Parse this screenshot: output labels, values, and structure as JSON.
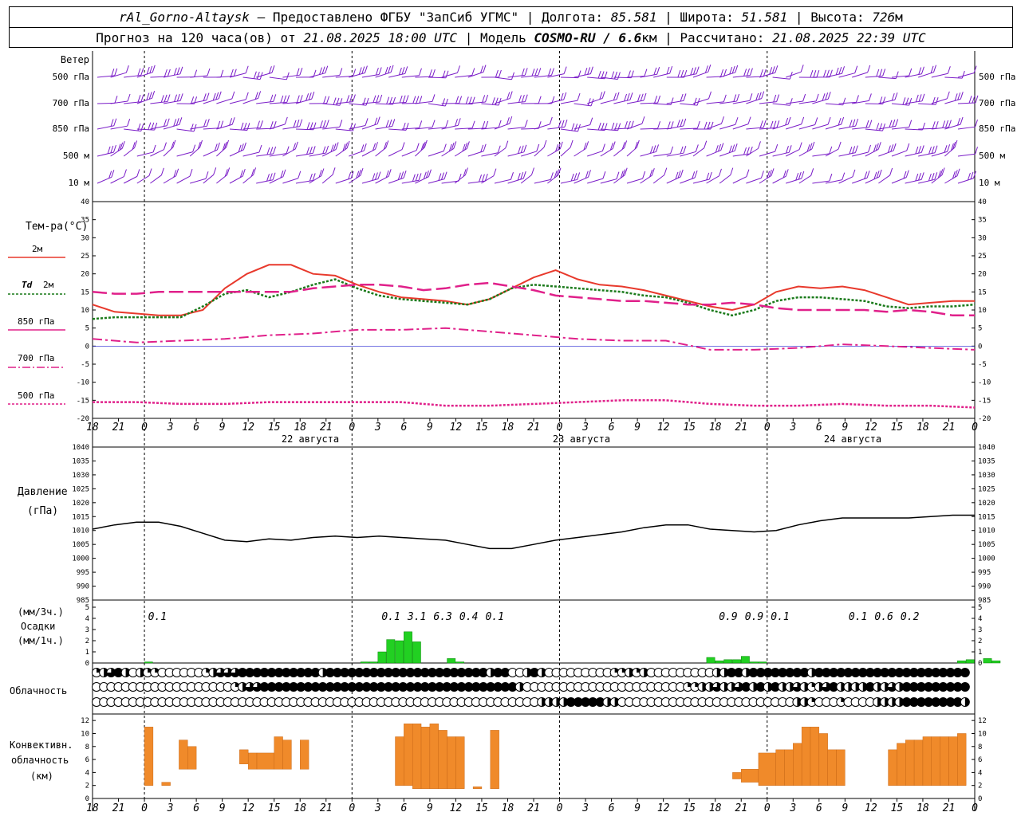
{
  "header": {
    "station": "rAl_Gorno-Altaysk",
    "provider": "Предоставлено ФГБУ \"ЗапСиб УГМС\"",
    "lon_label": "Долгота:",
    "lon": "85.581",
    "lat_label": "Широта:",
    "lat": "51.581",
    "alt_label": "Высота:",
    "alt": "726",
    "alt_unit": "м",
    "forecast_label": "Прогноз на 120 часа(ов) от",
    "forecast_start": "21.08.2025 18:00 UTC",
    "model_label": "Модель",
    "model": "COSMO-RU / 6.6",
    "model_unit": "км",
    "calc_label": "Рассчитано:",
    "calc_time": "21.08.2025 22:39 UTC"
  },
  "wind": {
    "title": "Ветер",
    "levels": [
      "500 гПа",
      "700 гПа",
      "850 гПа",
      "500 м",
      "10 м"
    ]
  },
  "labels": {
    "temp_title": "Тем-ра(°С)",
    "t2m": "2м",
    "td": "Td",
    "td2m": "2м",
    "t850": "850 гПа",
    "t700": "700 гПа",
    "t500": "500 гПа",
    "pressure_title": "Давление",
    "pressure_unit": "(гПа)",
    "precip_unit3": "(мм/3ч.)",
    "precip_title": "Осадки",
    "precip_unit1": "(мм/1ч.)",
    "cloud_title": "Облачность",
    "conv_title1": "Конвективн.",
    "conv_title2": "облачность",
    "conv_unit": "(км)"
  },
  "axis": {
    "time_ticks": [
      "18",
      "21",
      "0",
      "3",
      "6",
      "9",
      "12",
      "15",
      "18",
      "21",
      "0",
      "3",
      "6",
      "9",
      "12",
      "15",
      "18",
      "21",
      "0",
      "3",
      "6",
      "9",
      "12",
      "15",
      "18",
      "21",
      "0",
      "3",
      "6",
      "9",
      "12",
      "15",
      "18",
      "21",
      "0"
    ],
    "day_labels": [
      "22 августа",
      "23 августа",
      "24 августа"
    ],
    "temp_ticks": [
      "40",
      "35",
      "30",
      "25",
      "20",
      "15",
      "10",
      "5",
      "0",
      "-5",
      "-10",
      "-15",
      "-20"
    ],
    "pres_ticks": [
      "1040",
      "1035",
      "1030",
      "1025",
      "1020",
      "1015",
      "1010",
      "1005",
      "1000",
      "995",
      "990",
      "985"
    ],
    "precip_ticks": [
      "5",
      "4",
      "3",
      "2",
      "1",
      "0"
    ],
    "conv_ticks": [
      "12",
      "10",
      "8",
      "6",
      "4",
      "2",
      "0"
    ]
  },
  "colors": {
    "t2m": "#e8392c",
    "td": "#1a7a1a",
    "t850": "#e0208a",
    "t700": "#e0208a",
    "t500": "#e0208a",
    "zero_line": "#2020d0",
    "wind": "#7a1cc8",
    "precip": "#22d022",
    "conv": "#f08a2a",
    "pressure": "#000000"
  },
  "chart_data": [
    {
      "type": "line",
      "title": "Тем-ра(°С)",
      "x_unit": "hours since 21.08.2025 18:00 UTC",
      "ylim": [
        -20,
        40
      ],
      "series": [
        {
          "name": "2м",
          "x": [
            0,
            3,
            6,
            9,
            12,
            15,
            18,
            21,
            24,
            27,
            30,
            33,
            36,
            39,
            42,
            45,
            48,
            51,
            54,
            57,
            60,
            63,
            66,
            69,
            72,
            75,
            78,
            81,
            84,
            87,
            90,
            93,
            96,
            99,
            102,
            105,
            108,
            111,
            114,
            117,
            120
          ],
          "values": [
            11.5,
            9.5,
            9,
            8.5,
            8.5,
            10,
            16,
            20,
            22.5,
            22.5,
            20,
            19.5,
            17,
            15,
            13.5,
            13,
            12.5,
            11.5,
            13,
            16,
            19,
            21,
            18.5,
            17,
            16.5,
            15.5,
            14,
            12.5,
            11,
            10,
            11.5,
            15,
            16.5,
            16,
            16.5,
            15.5,
            13.5,
            11.5,
            12,
            12.5,
            12.5
          ]
        },
        {
          "name": "Td 2м",
          "x": [
            0,
            3,
            6,
            9,
            12,
            15,
            18,
            21,
            24,
            27,
            30,
            33,
            36,
            39,
            42,
            45,
            48,
            51,
            54,
            57,
            60,
            63,
            66,
            69,
            72,
            75,
            78,
            81,
            84,
            87,
            90,
            93,
            96,
            99,
            102,
            105,
            108,
            111,
            114,
            117,
            120
          ],
          "values": [
            7.5,
            8,
            8,
            8,
            8,
            11,
            14.5,
            15.5,
            13.5,
            15,
            17,
            18.5,
            16,
            14,
            13,
            12.5,
            12,
            11.5,
            13,
            16,
            17,
            16.5,
            16,
            15.5,
            15,
            14,
            13.5,
            12,
            10,
            8.5,
            10,
            12.5,
            13.5,
            13.5,
            13,
            12.5,
            11,
            10.5,
            11,
            11,
            11.5
          ]
        },
        {
          "name": "850 гПа",
          "x": [
            0,
            3,
            6,
            9,
            12,
            15,
            18,
            21,
            24,
            27,
            30,
            33,
            36,
            39,
            42,
            45,
            48,
            51,
            54,
            57,
            60,
            63,
            66,
            69,
            72,
            75,
            78,
            81,
            84,
            87,
            90,
            93,
            96,
            99,
            102,
            105,
            108,
            111,
            114,
            117,
            120
          ],
          "values": [
            15,
            14.5,
            14.5,
            15,
            15,
            15,
            15,
            15,
            15,
            15,
            16,
            16.5,
            17,
            17,
            16.5,
            15.5,
            16,
            17,
            17.5,
            16.5,
            15.5,
            14,
            13.5,
            13,
            12.5,
            12.5,
            12,
            11.5,
            11.5,
            12,
            11.5,
            10.5,
            10,
            10,
            10,
            10,
            9.5,
            10,
            9.5,
            8.5,
            8.5
          ]
        },
        {
          "name": "700 гПа",
          "x": [
            0,
            6,
            12,
            18,
            24,
            30,
            36,
            42,
            48,
            54,
            60,
            66,
            72,
            78,
            84,
            90,
            96,
            102,
            108,
            114,
            120
          ],
          "values": [
            2,
            1,
            1.5,
            2,
            3,
            3.5,
            4.5,
            4.5,
            5,
            4,
            3,
            2,
            1.5,
            1.5,
            -1,
            -1,
            -0.5,
            0.5,
            0,
            -0.5,
            -1
          ]
        },
        {
          "name": "500 гПа",
          "x": [
            0,
            6,
            12,
            18,
            24,
            30,
            36,
            42,
            48,
            54,
            60,
            66,
            72,
            78,
            84,
            90,
            96,
            102,
            108,
            114,
            120
          ],
          "values": [
            -15.5,
            -15.5,
            -16,
            -16,
            -15.5,
            -15.5,
            -15.5,
            -15.5,
            -16.5,
            -16.5,
            -16,
            -15.5,
            -15,
            -15,
            -16,
            -16.5,
            -16.5,
            -16,
            -16.5,
            -16.5,
            -17
          ]
        }
      ]
    },
    {
      "type": "line",
      "title": "Давление",
      "ylabel": "(гПа)",
      "ylim": [
        985,
        1040
      ],
      "series": [
        {
          "x": [
            0,
            3,
            6,
            9,
            12,
            15,
            18,
            21,
            24,
            27,
            30,
            33,
            36,
            39,
            42,
            45,
            48,
            51,
            54,
            57,
            60,
            63,
            66,
            69,
            72,
            75,
            78,
            81,
            84,
            87,
            90,
            93,
            96,
            99,
            102,
            105,
            108,
            111,
            114,
            117,
            120
          ],
          "values": [
            1010.5,
            1012,
            1013,
            1013,
            1011.5,
            1009,
            1006.5,
            1006,
            1007,
            1006.5,
            1007.5,
            1008,
            1007.5,
            1008,
            1007.5,
            1007,
            1006.5,
            1005,
            1003.5,
            1003.5,
            1005,
            1006.5,
            1007.5,
            1008.5,
            1009.5,
            1011,
            1012,
            1012,
            1010.5,
            1010,
            1009.5,
            1010,
            1012,
            1013.5,
            1014.5,
            1014.5,
            1014.5,
            1014.5,
            1015,
            1015.5,
            1015.5
          ]
        }
      ]
    },
    {
      "type": "bar",
      "title": "Осадки",
      "ylabel": "(мм/1ч.)",
      "ylim": [
        0,
        5
      ],
      "hourly_x": [
        6,
        31,
        32,
        33,
        34,
        35,
        36,
        37,
        38,
        39,
        40,
        41,
        42,
        43,
        44,
        45,
        46,
        71,
        72,
        73,
        74,
        75,
        76,
        77,
        78,
        79,
        80,
        81,
        82,
        83,
        84,
        85,
        86,
        99,
        100,
        101,
        102,
        103,
        104
      ],
      "hourly_values": [
        0.1,
        0.1,
        0.1,
        1,
        2.1,
        2,
        2.8,
        1.9,
        0,
        0,
        0,
        0.4,
        0.1,
        0,
        0,
        0,
        0,
        0.5,
        0.2,
        0.3,
        0.3,
        0.6,
        0.1,
        0.1,
        0,
        0,
        0,
        0,
        0,
        0,
        0,
        0,
        0,
        0,
        0.2,
        0.3,
        0,
        0.4,
        0.2
      ],
      "sums_3h": [
        {
          "x": 7.5,
          "label": "0.1"
        },
        {
          "x": 34.5,
          "label": "0.1"
        },
        {
          "x": 37.5,
          "label": "3.1"
        },
        {
          "x": 40.5,
          "label": "6.3"
        },
        {
          "x": 43.5,
          "label": "0.4"
        },
        {
          "x": 46.5,
          "label": "0.1"
        },
        {
          "x": 73.5,
          "label": "0.9"
        },
        {
          "x": 76.5,
          "label": "0.9"
        },
        {
          "x": 79.5,
          "label": "0.1"
        },
        {
          "x": 88.5,
          "label": "0.1"
        },
        {
          "x": 91.5,
          "label": "0.6"
        },
        {
          "x": 94.5,
          "label": "0.2"
        }
      ]
    },
    {
      "type": "bar",
      "title": "Облачность",
      "rows": [
        "high",
        "middle",
        "low"
      ],
      "values_okta": [
        [
          2,
          4,
          6,
          8,
          4,
          0,
          4,
          2,
          2,
          0,
          0,
          0,
          0,
          0,
          0,
          2,
          4,
          6,
          6,
          6,
          8,
          8,
          8,
          8,
          8,
          8,
          8,
          8,
          8,
          8,
          8,
          4,
          8,
          8,
          8,
          8,
          8,
          8,
          8,
          8,
          8,
          8,
          8,
          8,
          8,
          8,
          8,
          8,
          8,
          8,
          8,
          8,
          8,
          8,
          4,
          8,
          8,
          0,
          0,
          4,
          8,
          4,
          0,
          0,
          0,
          0,
          0,
          0,
          0,
          0,
          0,
          2,
          2,
          4,
          2,
          4,
          0,
          0,
          0,
          0,
          0,
          0,
          0,
          0,
          0,
          4,
          4,
          8,
          8,
          4,
          8,
          8,
          8,
          8,
          8,
          8,
          8,
          8,
          4,
          8,
          8,
          8,
          8,
          8,
          8,
          8,
          8,
          8,
          8,
          8,
          8,
          8,
          8,
          8,
          8,
          8,
          8,
          8,
          8,
          8,
          8
        ],
        [
          0,
          0,
          0,
          0,
          0,
          0,
          0,
          0,
          0,
          0,
          0,
          0,
          0,
          0,
          0,
          0,
          0,
          0,
          0,
          2,
          4,
          6,
          6,
          8,
          8,
          8,
          8,
          8,
          8,
          8,
          8,
          8,
          8,
          8,
          8,
          8,
          8,
          8,
          8,
          8,
          8,
          8,
          8,
          8,
          8,
          8,
          8,
          8,
          8,
          8,
          8,
          8,
          8,
          8,
          8,
          8,
          8,
          8,
          4,
          0,
          0,
          0,
          0,
          0,
          0,
          0,
          0,
          0,
          0,
          0,
          0,
          0,
          0,
          0,
          0,
          0,
          0,
          0,
          0,
          0,
          0,
          2,
          2,
          4,
          4,
          6,
          4,
          4,
          6,
          8,
          4,
          8,
          4,
          8,
          4,
          4,
          6,
          4,
          2,
          4,
          6,
          8,
          4,
          4,
          4,
          4,
          8,
          4,
          4,
          6,
          4,
          8,
          8,
          8,
          8,
          8,
          8,
          8,
          8,
          8,
          8
        ],
        [
          0,
          0,
          0,
          0,
          0,
          0,
          0,
          0,
          0,
          0,
          0,
          0,
          0,
          0,
          0,
          0,
          0,
          0,
          0,
          0,
          0,
          0,
          0,
          0,
          0,
          0,
          0,
          0,
          0,
          0,
          0,
          0,
          0,
          0,
          0,
          0,
          0,
          0,
          0,
          0,
          0,
          0,
          0,
          0,
          0,
          0,
          0,
          0,
          0,
          0,
          0,
          0,
          0,
          0,
          0,
          0,
          0,
          0,
          0,
          0,
          0,
          4,
          4,
          4,
          4,
          8,
          8,
          8,
          8,
          8,
          4,
          4,
          0,
          0,
          0,
          0,
          0,
          0,
          0,
          0,
          0,
          0,
          0,
          0,
          0,
          0,
          0,
          0,
          0,
          0,
          0,
          0,
          0,
          0,
          0,
          0,
          4,
          4,
          2,
          0,
          0,
          0,
          2,
          0,
          0,
          0,
          0,
          4,
          4,
          4,
          4,
          8,
          8,
          8,
          8,
          8,
          8,
          8,
          8,
          4,
          8
        ]
      ]
    },
    {
      "type": "bar",
      "title": "Конвективн. облачность",
      "ylabel": "(км)",
      "ylim": [
        0,
        13
      ],
      "x_start": [
        6,
        8,
        10,
        11,
        14,
        17,
        18,
        19,
        21,
        22,
        24,
        35,
        36,
        37,
        38,
        39,
        40,
        41,
        42,
        44,
        46,
        74,
        75,
        77,
        79,
        80,
        81,
        82,
        83,
        84,
        85,
        86,
        91,
        92,
        93,
        94,
        95,
        96,
        97,
        98,
        99,
        100
      ],
      "x_end": [
        7,
        9,
        11,
        12,
        17,
        18,
        19,
        21,
        22,
        23,
        25,
        36,
        37,
        38,
        39,
        40,
        41,
        42,
        43,
        45,
        47,
        75,
        77,
        79,
        80,
        81,
        82,
        83,
        84,
        85,
        86,
        87,
        92,
        93,
        94,
        95,
        96,
        97,
        98,
        99,
        100,
        101
      ],
      "bottoms": [
        2,
        2,
        4.5,
        4.5,
        5.3,
        5.3,
        4.5,
        4.5,
        4.5,
        4.5,
        4.5,
        2,
        2,
        1.5,
        1.5,
        1.5,
        1.5,
        1.5,
        1.5,
        1.5,
        1.5,
        3,
        2.5,
        2,
        2,
        2,
        2,
        2,
        2,
        2,
        2,
        2,
        2.5,
        2,
        2,
        2,
        2,
        2,
        2,
        2,
        2,
        2
      ],
      "tops": [
        11,
        2.5,
        9,
        8,
        5.3,
        7.5,
        7,
        7,
        9.5,
        9,
        9,
        9.5,
        11.5,
        11.5,
        11,
        11.5,
        10.5,
        9.5,
        9.5,
        1.8,
        10.5,
        4,
        4.5,
        7,
        7.5,
        7.5,
        8.5,
        11,
        11,
        10,
        7.5,
        7.5,
        2.5,
        7.5,
        8.5,
        9,
        9,
        9.5,
        9.5,
        9.5,
        9.5,
        10
      ]
    }
  ]
}
